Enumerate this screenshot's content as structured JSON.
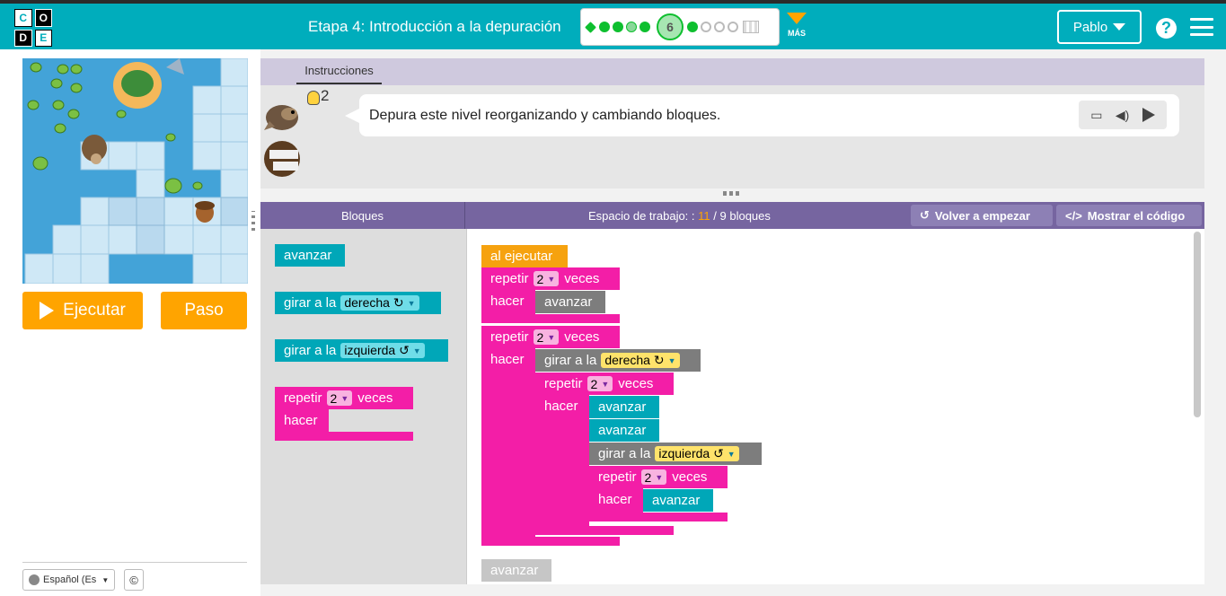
{
  "logo": {
    "letters": [
      "C",
      "O",
      "D",
      "E"
    ]
  },
  "header": {
    "stage_title": "Etapa 4: Introducción a la depuración",
    "current_level": "6",
    "more_label": "MÁS",
    "user_name": "Pablo",
    "help_glyph": "?"
  },
  "game": {
    "run_label": "Ejecutar",
    "step_label": "Paso",
    "language": "Español (Es",
    "copyright": "©"
  },
  "instructions": {
    "tab_label": "Instrucciones",
    "hint_count": "2",
    "text": "Depura este nivel reorganizando y cambiando bloques."
  },
  "workspace_header": {
    "toolbox_title": "Bloques",
    "workspace_label": "Espacio de trabajo: :",
    "block_count": "11",
    "block_total": "/ 9 bloques",
    "restart_label": "Volver a empezar",
    "show_code_label": "Mostrar el código"
  },
  "toolbox": {
    "move": "avanzar",
    "turn_prefix": "girar a la",
    "right": "derecha ↻",
    "left": "izquierda ↺",
    "repeat": "repetir",
    "repeat_count": "2",
    "times": "veces",
    "do": "hacer"
  },
  "program": {
    "when_run": "al ejecutar",
    "repeat": "repetir",
    "times": "veces",
    "do": "hacer",
    "count": "2",
    "move": "avanzar",
    "turn_prefix": "girar a la",
    "right": "derecha ↻",
    "left": "izquierda ↺",
    "orphan_move": "avanzar"
  },
  "icons": {
    "restart": "↺",
    "code": "</>",
    "dropdown": "▼"
  }
}
